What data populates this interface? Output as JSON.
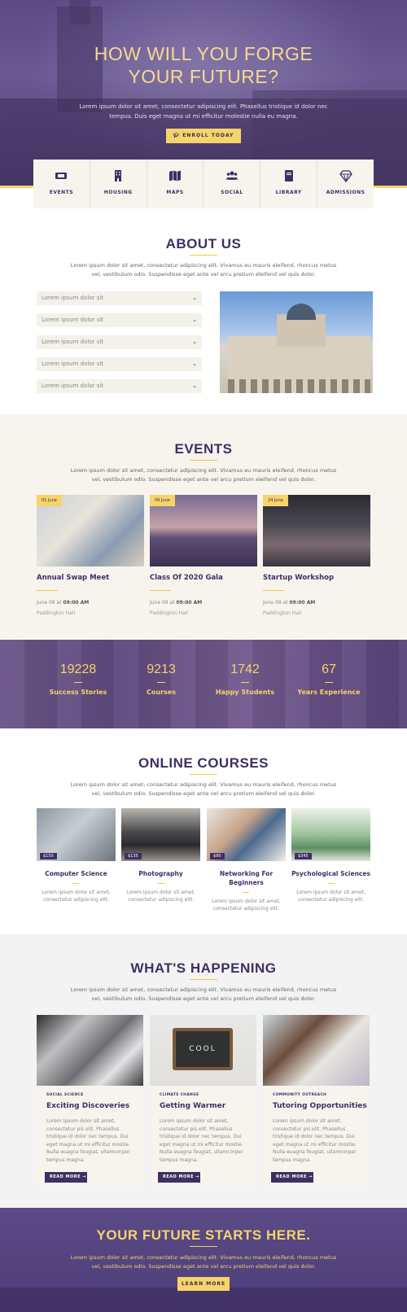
{
  "hero": {
    "title_line1": "HOW WILL YOU FORGE",
    "title_line2": "YOUR FUTURE?",
    "text": "Lorem ipsum dolor sit amet, consectetur adipiscing elit. Phasellus tristique id dolor nec tempus. Duis eget magna ut mi efficitur molestie nulla eu magna.",
    "enroll_label": "ENROLL TODAY"
  },
  "tiles": [
    {
      "label": "EVENTS",
      "icon": "ticket-icon"
    },
    {
      "label": "HOUSING",
      "icon": "building-icon"
    },
    {
      "label": "MAPS",
      "icon": "map-icon"
    },
    {
      "label": "SOCIAL",
      "icon": "users-icon"
    },
    {
      "label": "LIBRARY",
      "icon": "book-icon"
    },
    {
      "label": "ADMISSIONS",
      "icon": "diamond-icon"
    }
  ],
  "about": {
    "title": "ABOUT US",
    "text": "Lorem ipsum dolor sit amet, consectetur adipiscing elit. Vivamus eu mauris eleifend, rhoncus metus vel, vestibulum odio. Suspendisse eget ante vel arcu pretium eleifend vel quis dolor.",
    "accordion": [
      "Lorem ipsum dolor sit",
      "Lorem ipsum dolor sit",
      "Lorem ipsum dolor sit",
      "Lorem ipsum dolor sit",
      "Lorem ipsum dolor sit"
    ]
  },
  "events": {
    "title": "EVENTS",
    "text": "Lorem ipsum dolor sit amet, consectetur adipiscing elit. Vivamus eu mauris eleifend, rhoncus metus vel, vestibulum odio. Suspendisse eget ante vel arcu pretium eleifend vel quis dolor.",
    "items": [
      {
        "tag": "01 June",
        "title": "Annual Swap Meet",
        "date_prefix": "June 09 at",
        "time": "09:00 AM",
        "place": "Paddington Hall"
      },
      {
        "tag": "09 June",
        "title": "Class Of 2020 Gala",
        "date_prefix": "June 09 at",
        "time": "09:00 AM",
        "place": "Paddington Hall"
      },
      {
        "tag": "24 June",
        "title": "Startup Workshop",
        "date_prefix": "June 09 at",
        "time": "09:00 AM",
        "place": "Paddington Hall"
      }
    ]
  },
  "stats": [
    {
      "num": "19228",
      "label": "Success Stories"
    },
    {
      "num": "9213",
      "label": "Courses"
    },
    {
      "num": "1742",
      "label": "Happy Students"
    },
    {
      "num": "67",
      "label": "Years Experience"
    }
  ],
  "courses": {
    "title": "ONLINE COURSES",
    "text": "Lorem ipsum dolor sit amet, consectetur adipiscing elit. Vivamus eu mauris eleifend, rhoncus metus vel, vestibulum odio. Suspendisse eget ante vel arcu pretium eleifend vel quis dolor.",
    "items": [
      {
        "price": "$150",
        "title": "Computer Science",
        "desc": "Lorem ipsum dolor sit amet, consectetur adipiscing elit."
      },
      {
        "price": "$135",
        "title": "Photography",
        "desc": "Lorem ipsum dolor sit amet, consectetur adipiscing elit."
      },
      {
        "price": "$90",
        "title": "Networking For Beginners",
        "desc": "Lorem ipsum dolor sit amet, consectetur adipiscing elit."
      },
      {
        "price": "$345",
        "title": "Psychological Sciences",
        "desc": "Lorem ipsum dolor sit amet, consectetur adipiscing elit."
      }
    ]
  },
  "happening": {
    "title": "WHAT'S HAPPENING",
    "text": "Lorem ipsum dolor sit amet, consectetur adipiscing elit. Vivamus eu mauris eleifend, rhoncus metus vel, vestibulum odio. Suspendisse eget ante vel arcu pretium eleifend vel quis dolor.",
    "items": [
      {
        "cat": "SOCIAL SCIENCE",
        "title": "Exciting Discoveries",
        "text": "Lorem ipsum dolor sit amet, consectetur pis elit. Phasellus tristique id dolor nec tempus. Dui eget magna ut mi efficitur mostie. Nulla euagna feugiat, ullamcorper tempus magna.",
        "more": "READ MORE"
      },
      {
        "cat": "CLIMATE CHANGE",
        "title": "Getting Warmer",
        "text": "Lorem ipsum dolor sit amet, consectetur pis elit. Phasellus tristique id dolor nec tempus. Dui eget magna ut mi efficitur mostie. Nulla euagna feugiat, ullamcorper tempus magna.",
        "more": "READ MORE"
      },
      {
        "cat": "COMMUNITY OUTREACH",
        "title": "Tutoring Opportunities",
        "text": "Lorem ipsum dolor sit amet, consectetur pis elit. Phasellus tristique id dolor nec tempus. Dui eget magna ut mi efficitur mostie. Nulla euagna feugiat, ullamcorper tempus magna.",
        "more": "READ MORE"
      }
    ]
  },
  "cta": {
    "title": "YOUR FUTURE STARTS HERE.",
    "text": "Lorem ipsum dolor sit amet, consectetur adipiscing elit. Vivamus eu mauris eleifend, rhoncus metus vel, vestibulum odio. Suspendisse eget ante vel arcu pretium eleifend vel quis dolor.",
    "button": "LEARN MORE"
  },
  "colors": {
    "brand_purple": "#3f2f63",
    "accent_yellow": "#f6d36b",
    "cream": "#f7f4ee"
  }
}
